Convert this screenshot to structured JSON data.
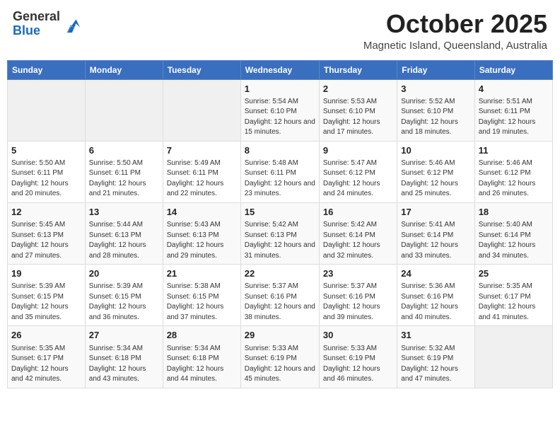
{
  "header": {
    "logo_general": "General",
    "logo_blue": "Blue",
    "month": "October 2025",
    "location": "Magnetic Island, Queensland, Australia"
  },
  "days_of_week": [
    "Sunday",
    "Monday",
    "Tuesday",
    "Wednesday",
    "Thursday",
    "Friday",
    "Saturday"
  ],
  "weeks": [
    [
      {
        "day": "",
        "text": ""
      },
      {
        "day": "",
        "text": ""
      },
      {
        "day": "",
        "text": ""
      },
      {
        "day": "1",
        "text": "Sunrise: 5:54 AM\nSunset: 6:10 PM\nDaylight: 12 hours and 15 minutes."
      },
      {
        "day": "2",
        "text": "Sunrise: 5:53 AM\nSunset: 6:10 PM\nDaylight: 12 hours and 17 minutes."
      },
      {
        "day": "3",
        "text": "Sunrise: 5:52 AM\nSunset: 6:10 PM\nDaylight: 12 hours and 18 minutes."
      },
      {
        "day": "4",
        "text": "Sunrise: 5:51 AM\nSunset: 6:11 PM\nDaylight: 12 hours and 19 minutes."
      }
    ],
    [
      {
        "day": "5",
        "text": "Sunrise: 5:50 AM\nSunset: 6:11 PM\nDaylight: 12 hours and 20 minutes."
      },
      {
        "day": "6",
        "text": "Sunrise: 5:50 AM\nSunset: 6:11 PM\nDaylight: 12 hours and 21 minutes."
      },
      {
        "day": "7",
        "text": "Sunrise: 5:49 AM\nSunset: 6:11 PM\nDaylight: 12 hours and 22 minutes."
      },
      {
        "day": "8",
        "text": "Sunrise: 5:48 AM\nSunset: 6:11 PM\nDaylight: 12 hours and 23 minutes."
      },
      {
        "day": "9",
        "text": "Sunrise: 5:47 AM\nSunset: 6:12 PM\nDaylight: 12 hours and 24 minutes."
      },
      {
        "day": "10",
        "text": "Sunrise: 5:46 AM\nSunset: 6:12 PM\nDaylight: 12 hours and 25 minutes."
      },
      {
        "day": "11",
        "text": "Sunrise: 5:46 AM\nSunset: 6:12 PM\nDaylight: 12 hours and 26 minutes."
      }
    ],
    [
      {
        "day": "12",
        "text": "Sunrise: 5:45 AM\nSunset: 6:13 PM\nDaylight: 12 hours and 27 minutes."
      },
      {
        "day": "13",
        "text": "Sunrise: 5:44 AM\nSunset: 6:13 PM\nDaylight: 12 hours and 28 minutes."
      },
      {
        "day": "14",
        "text": "Sunrise: 5:43 AM\nSunset: 6:13 PM\nDaylight: 12 hours and 29 minutes."
      },
      {
        "day": "15",
        "text": "Sunrise: 5:42 AM\nSunset: 6:13 PM\nDaylight: 12 hours and 31 minutes."
      },
      {
        "day": "16",
        "text": "Sunrise: 5:42 AM\nSunset: 6:14 PM\nDaylight: 12 hours and 32 minutes."
      },
      {
        "day": "17",
        "text": "Sunrise: 5:41 AM\nSunset: 6:14 PM\nDaylight: 12 hours and 33 minutes."
      },
      {
        "day": "18",
        "text": "Sunrise: 5:40 AM\nSunset: 6:14 PM\nDaylight: 12 hours and 34 minutes."
      }
    ],
    [
      {
        "day": "19",
        "text": "Sunrise: 5:39 AM\nSunset: 6:15 PM\nDaylight: 12 hours and 35 minutes."
      },
      {
        "day": "20",
        "text": "Sunrise: 5:39 AM\nSunset: 6:15 PM\nDaylight: 12 hours and 36 minutes."
      },
      {
        "day": "21",
        "text": "Sunrise: 5:38 AM\nSunset: 6:15 PM\nDaylight: 12 hours and 37 minutes."
      },
      {
        "day": "22",
        "text": "Sunrise: 5:37 AM\nSunset: 6:16 PM\nDaylight: 12 hours and 38 minutes."
      },
      {
        "day": "23",
        "text": "Sunrise: 5:37 AM\nSunset: 6:16 PM\nDaylight: 12 hours and 39 minutes."
      },
      {
        "day": "24",
        "text": "Sunrise: 5:36 AM\nSunset: 6:16 PM\nDaylight: 12 hours and 40 minutes."
      },
      {
        "day": "25",
        "text": "Sunrise: 5:35 AM\nSunset: 6:17 PM\nDaylight: 12 hours and 41 minutes."
      }
    ],
    [
      {
        "day": "26",
        "text": "Sunrise: 5:35 AM\nSunset: 6:17 PM\nDaylight: 12 hours and 42 minutes."
      },
      {
        "day": "27",
        "text": "Sunrise: 5:34 AM\nSunset: 6:18 PM\nDaylight: 12 hours and 43 minutes."
      },
      {
        "day": "28",
        "text": "Sunrise: 5:34 AM\nSunset: 6:18 PM\nDaylight: 12 hours and 44 minutes."
      },
      {
        "day": "29",
        "text": "Sunrise: 5:33 AM\nSunset: 6:19 PM\nDaylight: 12 hours and 45 minutes."
      },
      {
        "day": "30",
        "text": "Sunrise: 5:33 AM\nSunset: 6:19 PM\nDaylight: 12 hours and 46 minutes."
      },
      {
        "day": "31",
        "text": "Sunrise: 5:32 AM\nSunset: 6:19 PM\nDaylight: 12 hours and 47 minutes."
      },
      {
        "day": "",
        "text": ""
      }
    ]
  ]
}
